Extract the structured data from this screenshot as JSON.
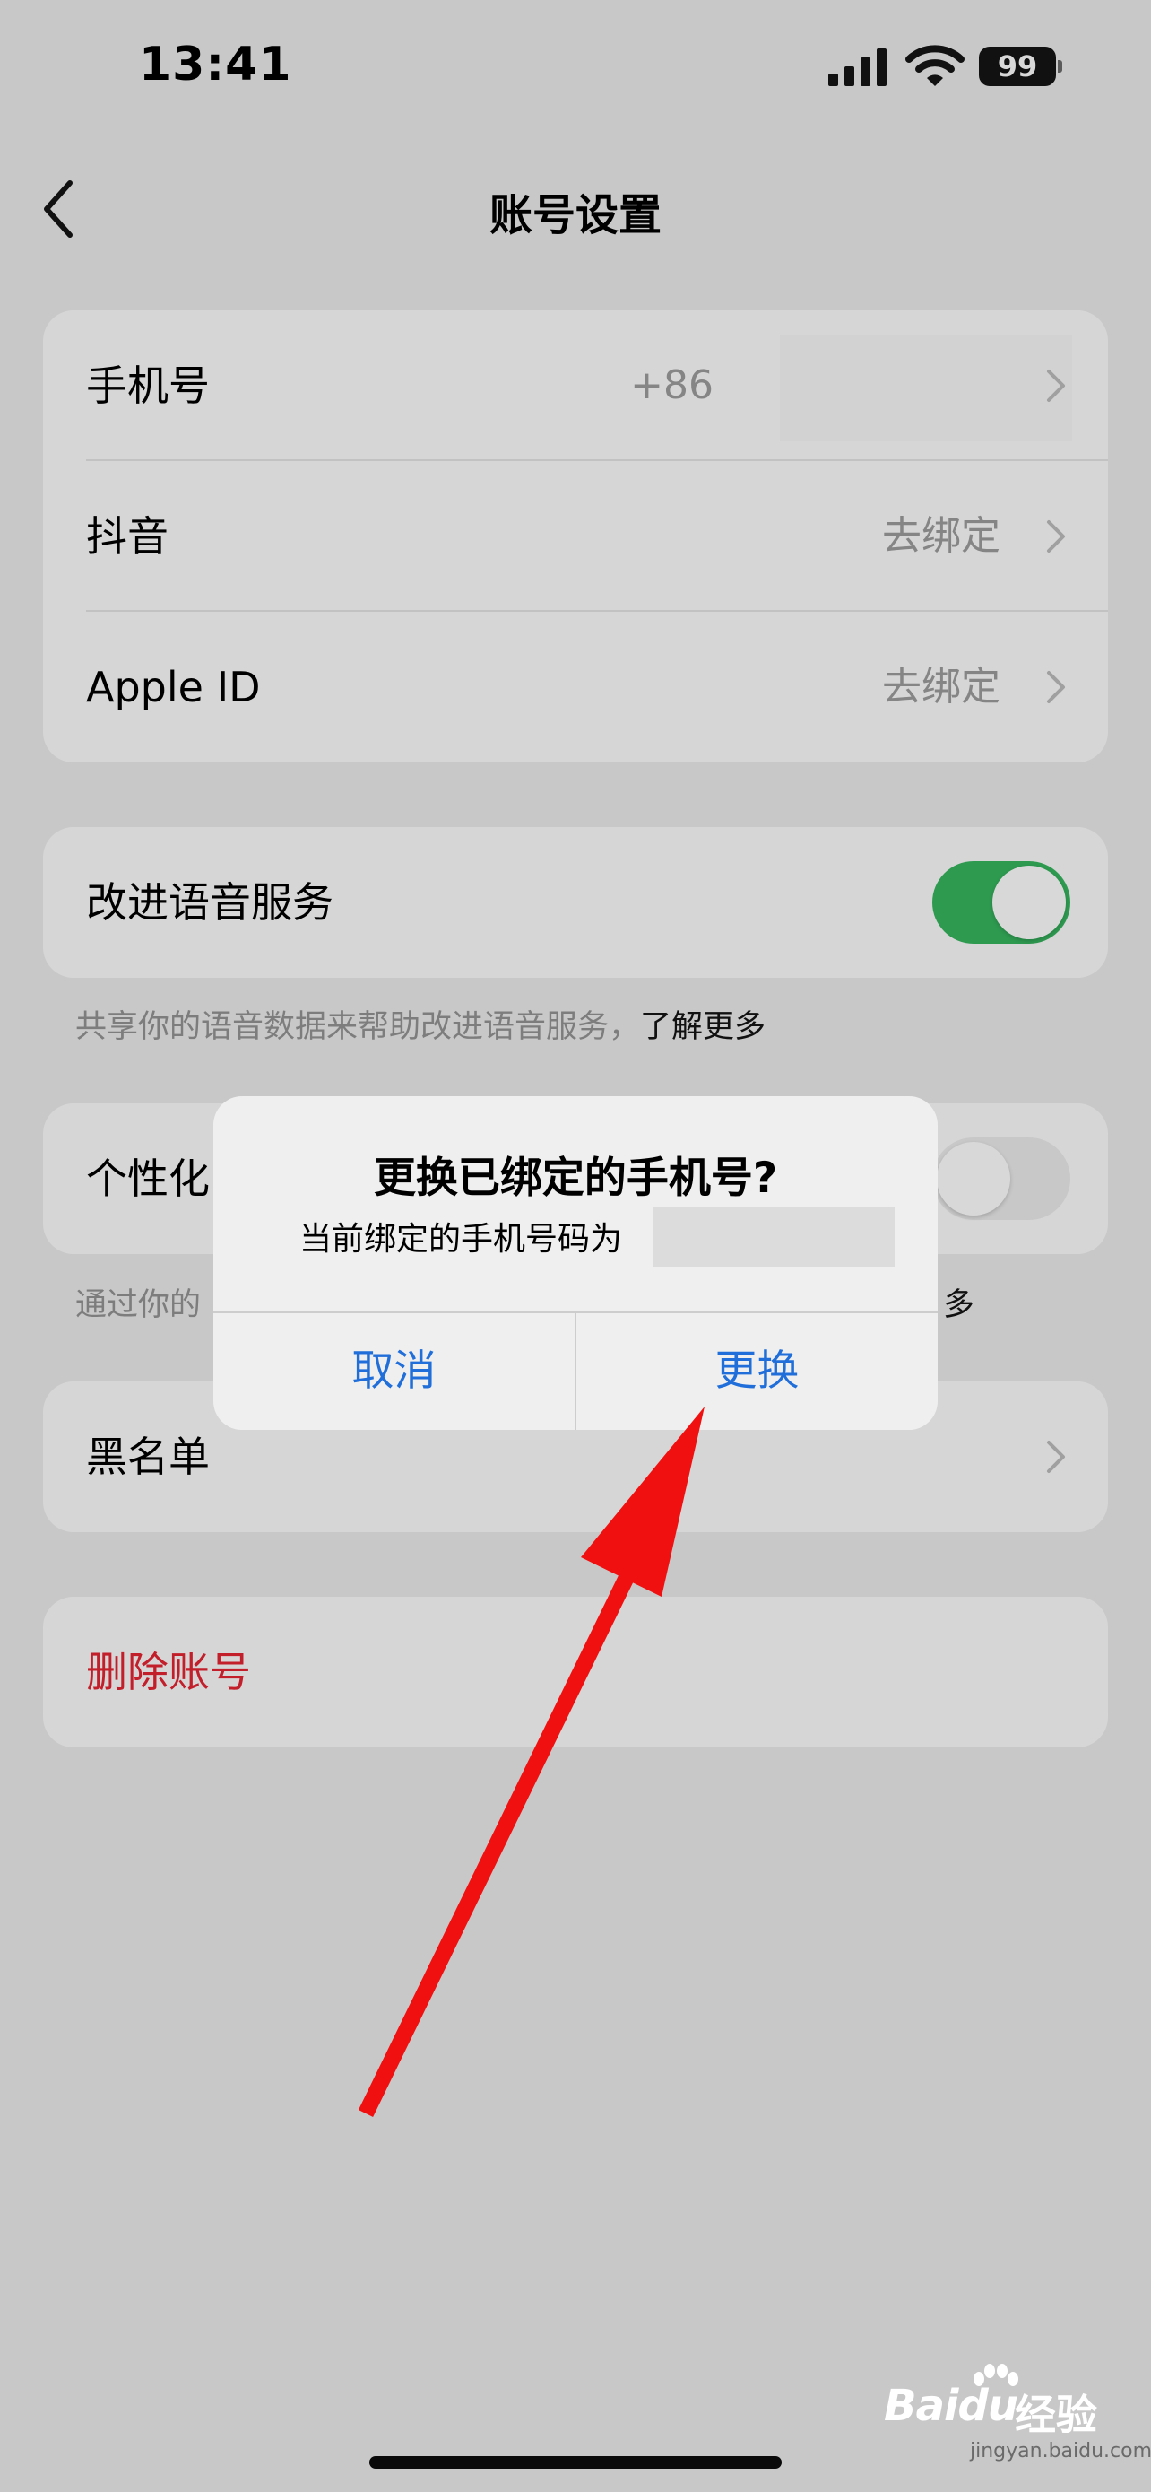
{
  "status_bar": {
    "time": "13:41",
    "battery": "99",
    "icons": [
      "signal-icon",
      "wifi-icon",
      "battery-icon"
    ]
  },
  "nav": {
    "title": "账号设置",
    "back_icon": "chevron-left-icon"
  },
  "account_group": [
    {
      "label": "手机号",
      "value": "+86"
    },
    {
      "label": "抖音",
      "value": "去绑定"
    },
    {
      "label": "Apple ID",
      "value": "去绑定"
    }
  ],
  "voice_service": {
    "label": "改进语音服务",
    "enabled": true,
    "footnote": "共享你的语音数据来帮助改进语音服务，",
    "footnote_link": "了解更多"
  },
  "personalization": {
    "label": "个性化",
    "enabled": false,
    "footnote": "通过你的",
    "footnote_link_tail": "多"
  },
  "blacklist": {
    "label": "黑名单"
  },
  "delete_account": {
    "label": "删除账号",
    "color": "#c21f2b"
  },
  "alert": {
    "title": "更换已绑定的手机号?",
    "message": "当前绑定的手机号码为",
    "cancel": "取消",
    "confirm": "更换",
    "button_color": "#1f6ed9"
  },
  "watermark": {
    "logo": "Baidu",
    "label": "经验",
    "url": "jingyan.baidu.com"
  },
  "colors": {
    "background": "#c8c8c8",
    "toggle_on": "#2e9a50",
    "annotation_arrow": "#f01010"
  }
}
